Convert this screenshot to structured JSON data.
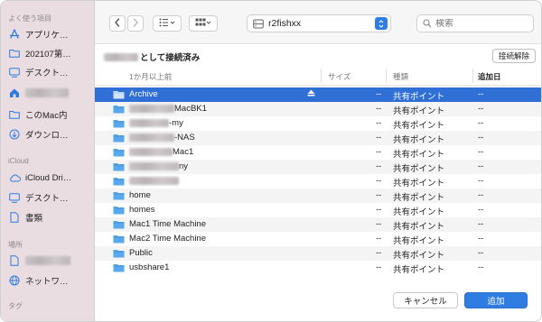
{
  "sidebar": {
    "sections": {
      "favorites": "よく使う項目",
      "icloud": "iCloud",
      "locations": "場所",
      "tags": "タグ"
    },
    "favorites": [
      {
        "label": "アプリケ…",
        "icon": "apps-icon"
      },
      {
        "label": "202107第…",
        "icon": "folder-icon"
      },
      {
        "label": "デスクト…",
        "icon": "desktop-icon"
      },
      {
        "label": "",
        "icon": "home-icon"
      },
      {
        "label": "このMac内",
        "icon": "folder-icon"
      },
      {
        "label": "ダウンロ…",
        "icon": "download-icon"
      }
    ],
    "icloud": [
      {
        "label": "iCloud Dri…",
        "icon": "cloud-icon"
      },
      {
        "label": "デスクト…",
        "icon": "desktop-icon"
      },
      {
        "label": "書類",
        "icon": "document-icon"
      }
    ],
    "locations": [
      {
        "label": "",
        "icon": "document-icon"
      },
      {
        "label": "ネットワ…",
        "icon": "network-icon"
      }
    ]
  },
  "toolbar": {
    "location": "r2fishxx",
    "search_placeholder": "検索"
  },
  "connection": {
    "label_suffix": "として接続済み",
    "disconnect": "接続解除"
  },
  "table": {
    "headers": {
      "name": "1か月以上前",
      "size": "サイズ",
      "kind": "種類",
      "added": "追加日"
    },
    "rows": [
      {
        "name": "Archive",
        "size": "--",
        "kind": "共有ポイント",
        "added": "--",
        "selected": true
      },
      {
        "name": "MacBK1",
        "size": "--",
        "kind": "共有ポイント",
        "added": "--"
      },
      {
        "name": "-my",
        "size": "--",
        "kind": "共有ポイント",
        "added": "--"
      },
      {
        "name": "-NAS",
        "size": "--",
        "kind": "共有ポイント",
        "added": "--"
      },
      {
        "name": "Mac1",
        "size": "--",
        "kind": "共有ポイント",
        "added": "--"
      },
      {
        "name": "ny",
        "size": "--",
        "kind": "共有ポイント",
        "added": "--"
      },
      {
        "name": "",
        "size": "--",
        "kind": "共有ポイント",
        "added": "--"
      },
      {
        "name": "home",
        "size": "--",
        "kind": "共有ポイント",
        "added": "--"
      },
      {
        "name": "homes",
        "size": "--",
        "kind": "共有ポイント",
        "added": "--"
      },
      {
        "name": "Mac1 Time Machine",
        "size": "--",
        "kind": "共有ポイント",
        "added": "--"
      },
      {
        "name": "Mac2 Time Machine",
        "size": "--",
        "kind": "共有ポイント",
        "added": "--"
      },
      {
        "name": "Public",
        "size": "--",
        "kind": "共有ポイント",
        "added": "--"
      },
      {
        "name": "usbshare1",
        "size": "--",
        "kind": "共有ポイント",
        "added": "--"
      }
    ]
  },
  "buttons": {
    "cancel": "キャンセル",
    "add": "追加"
  },
  "colors": {
    "accent": "#2f7de1",
    "selection": "#2f6fd6",
    "sidebar_bg": "#eadde1"
  }
}
